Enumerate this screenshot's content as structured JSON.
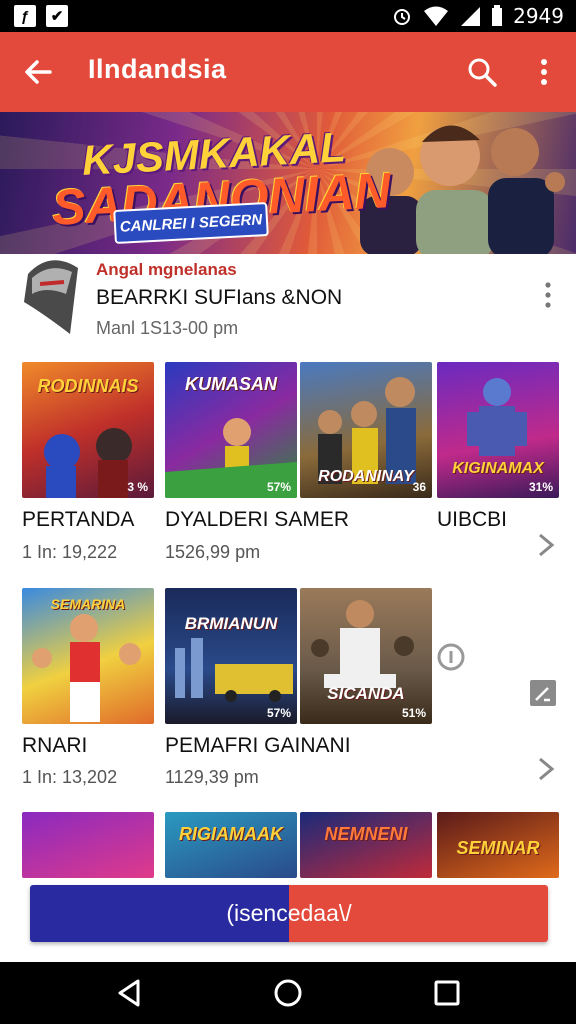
{
  "status_bar": {
    "time": "2949"
  },
  "app_bar": {
    "title": "Ilndandsia"
  },
  "banner": {
    "line1": "KJSMKAKAL",
    "line2": "SADANONIAN",
    "pill": "CANLREI I SEGERN"
  },
  "featured": {
    "category": "Angal mgnelanas",
    "title": "BEARRKI SUFIans &NON",
    "time": "Manl 1S13-00 pm"
  },
  "rows": [
    {
      "items": [
        {
          "label": "PERTANDA",
          "sub": "1 In:  19,222",
          "tile_title": "RODINNAIS",
          "tile_pct": "3 %"
        },
        {
          "label": "DYALDERI SAMER",
          "sub": "1526,99 pm",
          "tile_title": "KUMASAN",
          "tile_pct": "57%"
        },
        {
          "label": "",
          "sub": "",
          "tile_title": "RODANINAY",
          "tile_pct": "36"
        },
        {
          "label": "UIBCBI",
          "sub": "",
          "tile_title": "KIGINAMAX",
          "tile_pct": "31%"
        }
      ]
    },
    {
      "items": [
        {
          "label": "RNARI",
          "sub": "1 In:  13,202",
          "tile_title": "SEMARINA",
          "tile_pct": ""
        },
        {
          "label": "PEMAFRI GAINANI",
          "sub": "1129,39 pm",
          "tile_title": "BRMIANUN",
          "tile_pct": "57%"
        },
        {
          "label": "",
          "sub": "",
          "tile_title": "SICANDA",
          "tile_pct": "51%"
        }
      ]
    },
    {
      "items": [
        {
          "tile_title": ""
        },
        {
          "tile_title": "RIGIAMAAK"
        },
        {
          "tile_title": "NEMNENI"
        },
        {
          "tile_title": "SEMINAR"
        }
      ]
    }
  ],
  "cta": {
    "label": "(isencedaa\\/"
  },
  "colors": {
    "primary": "#e34a3c",
    "accent_blue": "#2a2aa0"
  }
}
